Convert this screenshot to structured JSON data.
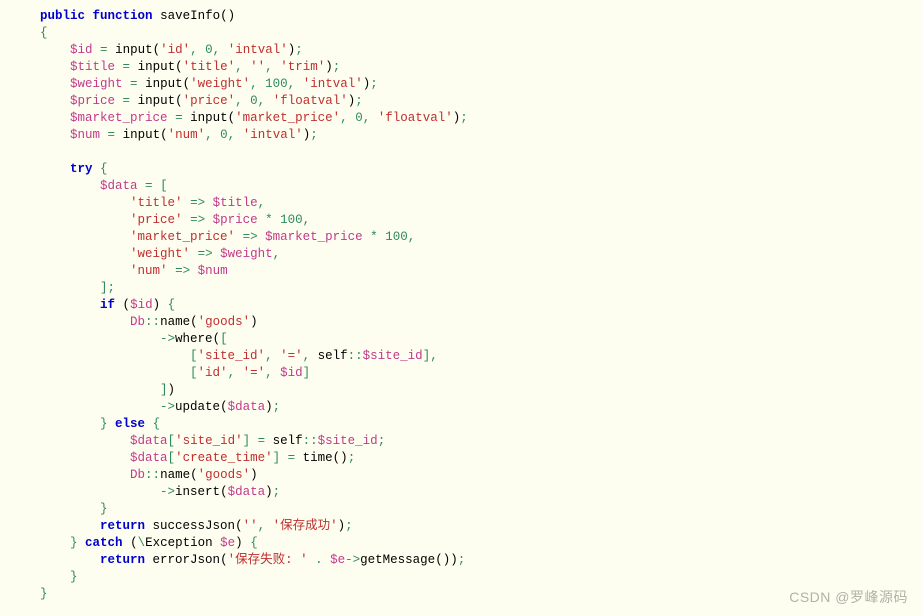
{
  "code": {
    "fn_decl": {
      "visibility": "public",
      "keyword": "function",
      "name": "saveInfo"
    },
    "assigns": [
      {
        "pad": "        ",
        "var": "$id",
        "fn": "input",
        "args": [
          "'id'",
          "0",
          "'intval'"
        ]
      },
      {
        "pad": "        ",
        "var": "$title",
        "fn": "input",
        "args": [
          "'title'",
          "''",
          "'trim'"
        ]
      },
      {
        "pad": "        ",
        "var": "$weight",
        "fn": "input",
        "args": [
          "'weight'",
          "100",
          "'intval'"
        ]
      },
      {
        "pad": "        ",
        "var": "$price",
        "fn": "input",
        "args": [
          "'price'",
          "0",
          "'floatval'"
        ]
      },
      {
        "pad": "        ",
        "var": "$market_price",
        "fn": "input",
        "args": [
          "'market_price'",
          "0",
          "'floatval'"
        ]
      },
      {
        "pad": "        ",
        "var": "$num",
        "fn": "input",
        "args": [
          "'num'",
          "0",
          "'intval'"
        ]
      }
    ],
    "try_kw": "try",
    "data_var": "$data",
    "data_lines": [
      {
        "pad": "                ",
        "key": "'title'",
        "val": "$title",
        "mult": false
      },
      {
        "pad": "                ",
        "key": "'price'",
        "val": "$price",
        "mult": true,
        "num": "100"
      },
      {
        "pad": "                ",
        "key": "'market_price'",
        "val": "$market_price",
        "mult": true,
        "num": "100"
      },
      {
        "pad": "                ",
        "key": "'weight'",
        "val": "$weight",
        "mult": false
      },
      {
        "pad": "                ",
        "key": "'num'",
        "val": "$num",
        "mult": false,
        "last": true
      }
    ],
    "if_kw": "if",
    "if_var": "$id",
    "db_cls": "Db",
    "name_method": "name",
    "goods_str": "'goods'",
    "where_method": "where",
    "where_rows": [
      {
        "pad": "                        ",
        "items": [
          "'site_id'",
          "'='",
          "self::$site_id"
        ]
      },
      {
        "pad": "                        ",
        "items": [
          "'id'",
          "'='",
          "$id"
        ],
        "last": true
      }
    ],
    "update_method": "update",
    "else_kw": "else",
    "else_lines": [
      {
        "pad": "                ",
        "var": "$data",
        "idx": "'site_id'",
        "rhs_type": "self",
        "rhs": "self::$site_id"
      },
      {
        "pad": "                ",
        "var": "$data",
        "idx": "'create_time'",
        "rhs_type": "call",
        "rhs": "time"
      }
    ],
    "insert_method": "insert",
    "return_kw": "return",
    "success_fn": "successJson",
    "success_args": [
      "''",
      "'保存成功'"
    ],
    "catch_kw": "catch",
    "exc_cls": "Exception",
    "exc_var": "$e",
    "error_fn": "errorJson",
    "error_str": "'保存失败: '",
    "get_msg": "getMessage"
  },
  "watermark": "CSDN @罗峰源码"
}
